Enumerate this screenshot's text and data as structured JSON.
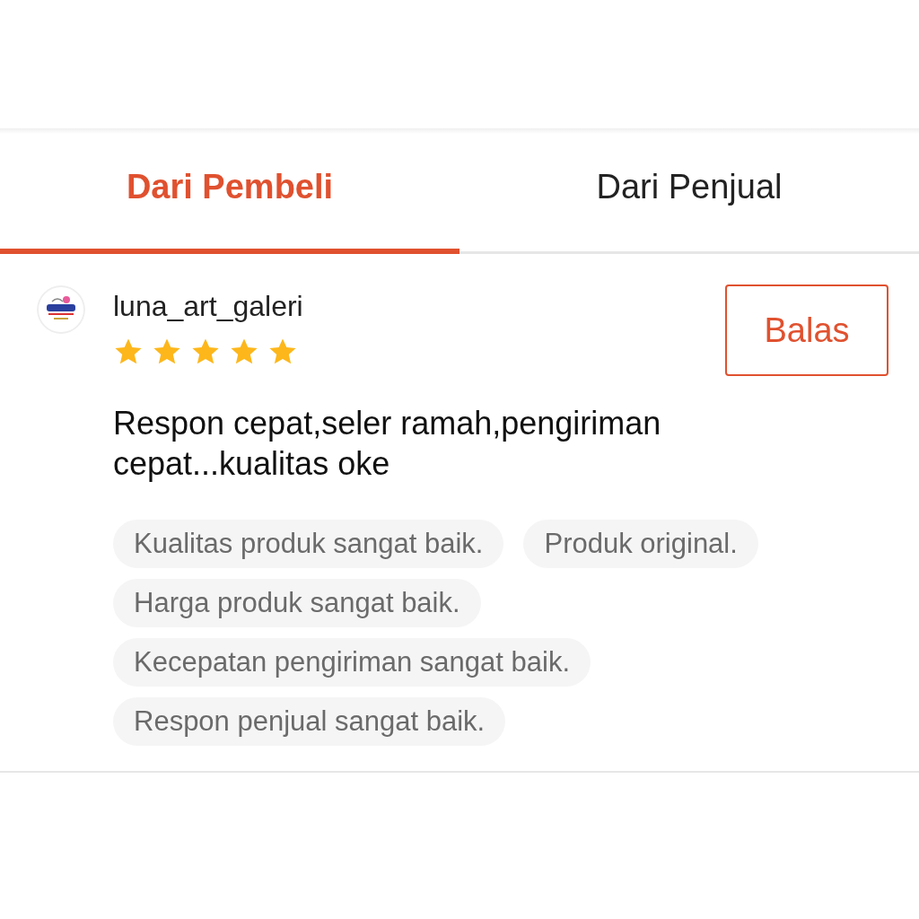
{
  "tabs": [
    {
      "label": "Dari Pembeli",
      "selected": true
    },
    {
      "label": "Dari Penjual",
      "selected": false
    }
  ],
  "review": {
    "username": "luna_art_galeri",
    "stars": 5,
    "reply_button": "Balas",
    "text": "Respon cepat,seler ramah,pengiriman cepat...kualitas oke",
    "tags": [
      "Kualitas produk sangat baik.",
      "Produk original.",
      "Harga produk sangat baik.",
      "Kecepatan pengiriman sangat baik.",
      "Respon penjual sangat baik."
    ]
  }
}
